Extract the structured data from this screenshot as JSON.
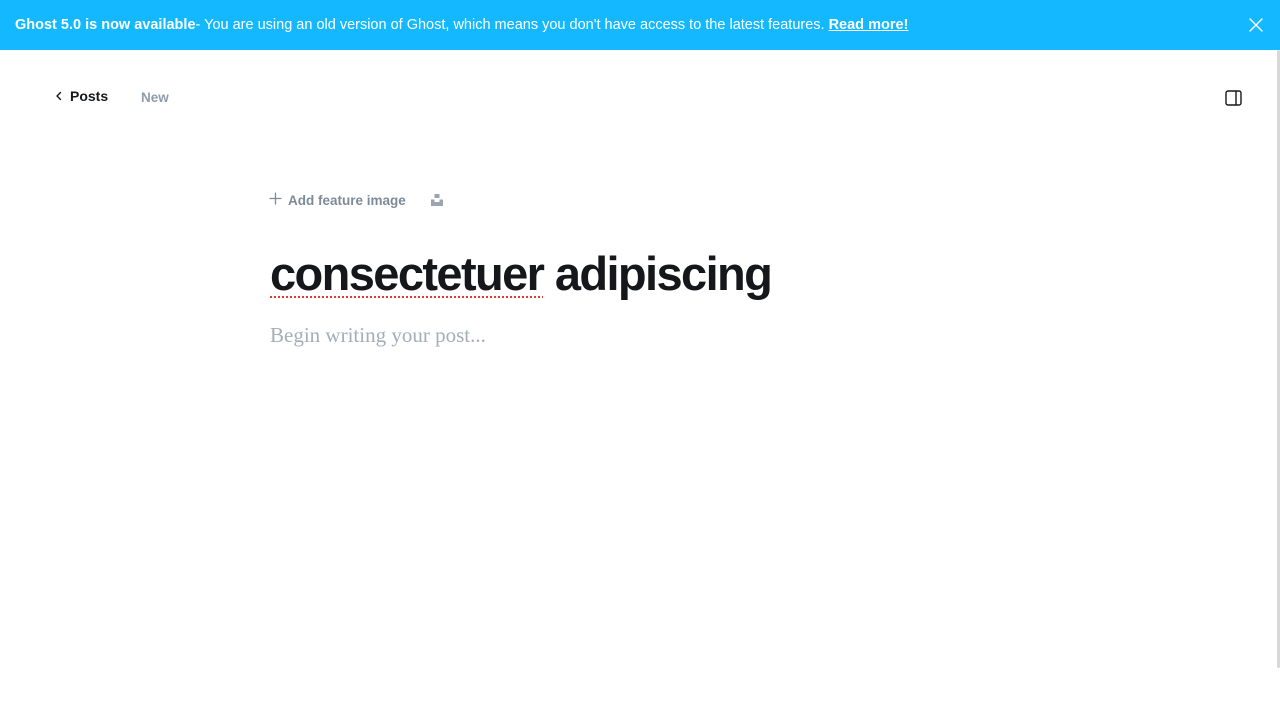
{
  "banner": {
    "headline": "Ghost 5.0 is now available",
    "message": " - You are using an old version of Ghost, which means you don't have access to the latest features.",
    "link_label": "Read more!",
    "close_icon": "close-icon",
    "background": "#14b8ff"
  },
  "nav": {
    "back_label": "Posts",
    "back_icon": "chevron-left-icon",
    "status": "New",
    "settings_icon": "sidebar-toggle-icon"
  },
  "editor": {
    "feature_image_label": "Add feature image",
    "feature_image_icon": "plus-icon",
    "unsplash_icon": "unsplash-icon",
    "title_word1": "consectetuer",
    "title_word2": " adipiscing",
    "body_placeholder": "Begin writing your post..."
  }
}
